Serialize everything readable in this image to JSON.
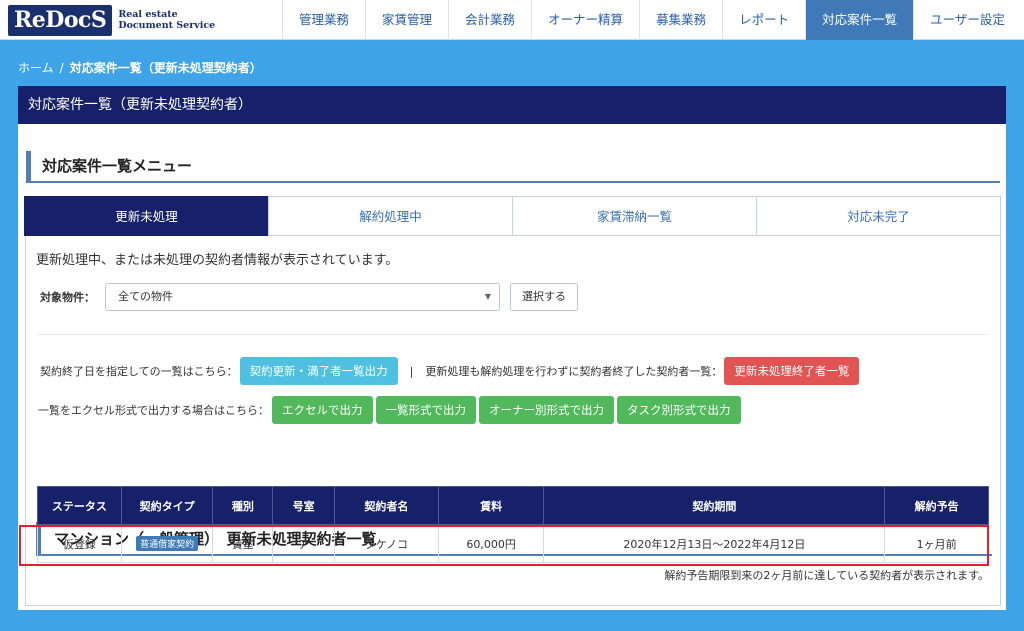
{
  "header": {
    "logo_main": "ReDocS",
    "logo_sub_line1": "Real estate",
    "logo_sub_line2": "Document Service",
    "nav": [
      {
        "label": "管理業務"
      },
      {
        "label": "家賃管理"
      },
      {
        "label": "会計業務"
      },
      {
        "label": "オーナー精算"
      },
      {
        "label": "募集業務"
      },
      {
        "label": "レポート"
      },
      {
        "label": "対応案件一覧"
      },
      {
        "label": "ユーザー設定"
      }
    ]
  },
  "breadcrumb": {
    "home": "ホーム",
    "separator": "/",
    "current": "対応案件一覧（更新未処理契約者）"
  },
  "panel": {
    "title": "対応案件一覧（更新未処理契約者）",
    "menu_heading": "対応案件一覧メニュー",
    "tabs": [
      {
        "label": "更新未処理"
      },
      {
        "label": "解約処理中"
      },
      {
        "label": "家賃滞納一覧"
      },
      {
        "label": "対応未完了"
      }
    ],
    "description": "更新処理中、または未処理の契約者情報が表示されています。",
    "filter": {
      "label": "対象物件：",
      "selected": "全ての物件",
      "select_button": "選択する"
    },
    "line1": {
      "text1": "契約終了日を指定しての一覧はこちら：",
      "button1": "契約更新・満了者一覧出力",
      "separator": "|",
      "text2": "更新処理も解約処理を行わずに契約者終了した契約者一覧：",
      "button2": "更新未処理終了者一覧"
    },
    "line2": {
      "text": "一覧をエクセル形式で出力する場合はこちら：",
      "buttons": [
        {
          "label": "エクセルで出力"
        },
        {
          "label": "一覧形式で出力"
        },
        {
          "label": "オーナー別形式で出力"
        },
        {
          "label": "タスク別形式で出力"
        }
      ]
    },
    "list_heading": "マンション（一般管理）　更新未処理契約者一覧",
    "table": {
      "headers": [
        "ステータス",
        "契約タイプ",
        "種別",
        "号室",
        "契約者名",
        "賃料",
        "契約期間",
        "解約予告"
      ],
      "rows": [
        {
          "status": "仮登録",
          "type": "普通借家契約",
          "kind": "賃室",
          "room": "ア",
          "name": "タケノコ",
          "rent": "60,000円",
          "period": "2020年12月13日〜2022年4月12日",
          "notice": "1ヶ月前"
        }
      ]
    },
    "footnote": "解約予告期限到来の2ヶ月前に達している契約者が表示されます。"
  }
}
